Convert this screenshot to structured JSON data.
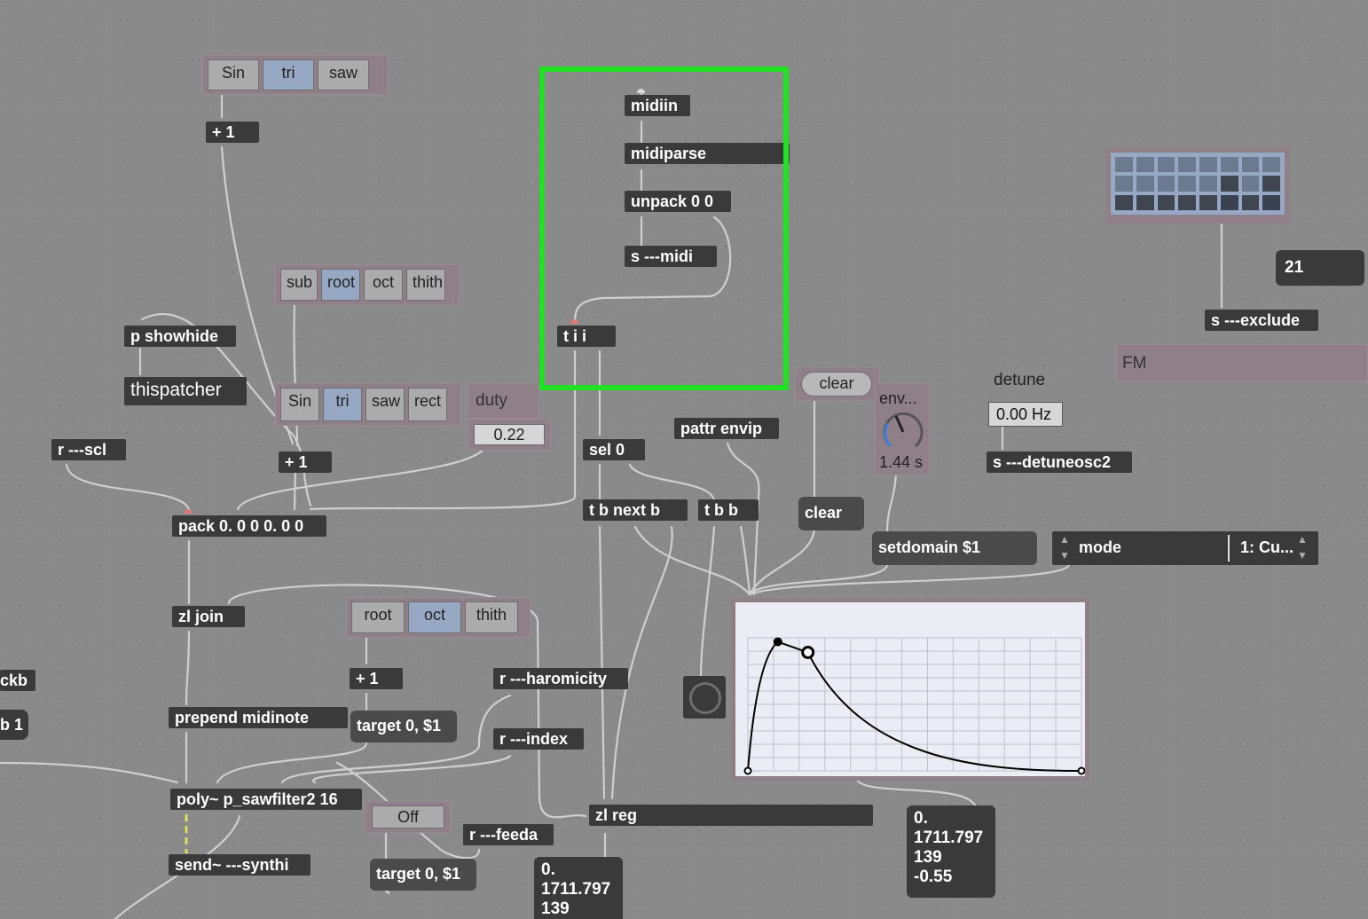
{
  "wave_menu_1": {
    "items": [
      "Sin",
      "tri",
      "saw"
    ],
    "selected": 1
  },
  "wave_menu_2": {
    "items": [
      "Sin",
      "tri",
      "saw",
      "rect"
    ],
    "selected": 1
  },
  "interval_menu_1": {
    "items": [
      "sub",
      "root",
      "oct",
      "thith"
    ],
    "selected": 1
  },
  "interval_menu_2": {
    "items": [
      "root",
      "oct",
      "thith"
    ],
    "selected": 1
  },
  "objects": {
    "plus1_a": "+ 1",
    "plus1_b": "+ 1",
    "plus1_c": "+ 1",
    "p_showhide": "p showhide",
    "r_scl": "r ---scl",
    "pack": "pack 0. 0 0 0. 0 0",
    "zl_join": "zl join",
    "prepend": "prepend midinote",
    "poly": "poly~ p_sawfilter2 16",
    "send_synth": "send~ ---synthi",
    "ckb": "ckb",
    "b1": "b 1",
    "midiin": "midiin",
    "midiparse": "midiparse",
    "unpack": "unpack 0 0",
    "s_midi": "s ---midi",
    "tii": "t i i",
    "sel0": "sel 0",
    "tbnext": "t b next b",
    "tbb": "t b b",
    "pattr": "pattr envip",
    "r_harm": "r ---haromicity",
    "r_index": "r ---index",
    "r_feeda": "r ---feeda",
    "zl_reg": "zl reg",
    "s_exclude": "s ---exclude",
    "s_detune": "s ---detuneosc2"
  },
  "messages": {
    "target1": "target 0, $1",
    "target2": "target 0, $1",
    "clear_msg": "clear",
    "setdomain": "setdomain $1"
  },
  "ui": {
    "thispatcher": "thispatcher",
    "duty_label": "duty",
    "duty_value": "0.22",
    "toggle_label": "Off",
    "clear_button": "clear",
    "dial_label": "env...",
    "dial_value": "1.44 s",
    "detune_label": "detune",
    "detune_value": "0.00 Hz",
    "number_box": "21",
    "fm_label": "FM",
    "mode_label": "mode",
    "mode_value": "1: Cu...",
    "float_out_1": "0.\n1711.797\n139\n-0.55",
    "float_out_2": "0.\n1711.797\n139"
  },
  "envelope": {
    "points": [
      [
        0,
        0
      ],
      [
        0.09,
        0.97
      ],
      [
        0.18,
        0.89
      ],
      [
        1,
        0
      ]
    ],
    "selected_point": 2
  },
  "colors": {
    "canvas": "#8a8a8a",
    "object": "#3a3a3a",
    "selected": "#96a8c4",
    "highlight": "#22e022",
    "cable": "#cfcfcf"
  }
}
